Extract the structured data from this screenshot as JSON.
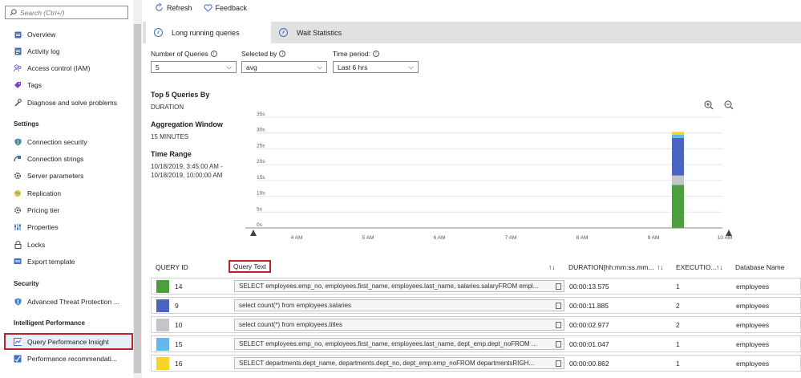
{
  "sidebar": {
    "search_placeholder": "Search (Ctrl+/)",
    "items": [
      {
        "label": "Overview",
        "icon": "overview-icon"
      },
      {
        "label": "Activity log",
        "icon": "activity-log-icon"
      },
      {
        "label": "Access control (IAM)",
        "icon": "people-icon"
      },
      {
        "label": "Tags",
        "icon": "tag-icon"
      },
      {
        "label": "Diagnose and solve problems",
        "icon": "wrench-icon"
      }
    ],
    "settings_header": "Settings",
    "settings_items": [
      {
        "label": "Connection security",
        "icon": "shield-icon"
      },
      {
        "label": "Connection strings",
        "icon": "plug-icon"
      },
      {
        "label": "Server parameters",
        "icon": "gear-icon"
      },
      {
        "label": "Replication",
        "icon": "globe-icon"
      },
      {
        "label": "Pricing tier",
        "icon": "gear-icon"
      },
      {
        "label": "Properties",
        "icon": "sliders-icon"
      },
      {
        "label": "Locks",
        "icon": "lock-icon"
      },
      {
        "label": "Export template",
        "icon": "export-icon"
      }
    ],
    "security_header": "Security",
    "security_items": [
      {
        "label": "Advanced Threat Protection ...",
        "icon": "shield-icon"
      }
    ],
    "intelligent_header": "Intelligent Performance",
    "intelligent_items": [
      {
        "label": "Query Performance Insight",
        "icon": "chart-icon"
      },
      {
        "label": "Performance recommendati...",
        "icon": "recommendation-icon"
      }
    ]
  },
  "toolbar": {
    "refresh": "Refresh",
    "feedback": "Feedback"
  },
  "tabs": [
    {
      "label": "Long running queries"
    },
    {
      "label": "Wait Statistics"
    }
  ],
  "filters": {
    "num_queries_label": "Number of Queries",
    "num_queries_value": "5",
    "selected_by_label": "Selected by",
    "selected_by_value": "avg",
    "time_period_label": "Time period:",
    "time_period_value": "Last 6 hrs"
  },
  "info": {
    "top_header": "Top 5 Queries By",
    "top_value": "DURATION",
    "agg_header": "Aggregation Window",
    "agg_value": "15 MINUTES",
    "range_header": "Time Range",
    "range_value": "10/18/2019, 3:45:00 AM - 10/18/2019, 10:00:00 AM"
  },
  "chart_data": {
    "type": "bar",
    "stacked": true,
    "y_ticks": [
      "0s",
      "5s",
      "10s",
      "15s",
      "20s",
      "25s",
      "30s",
      "35s"
    ],
    "x_ticks": [
      "4 AM",
      "5 AM",
      "6 AM",
      "7 AM",
      "8 AM",
      "9 AM",
      "10 AM"
    ],
    "ylim": [
      0,
      35
    ],
    "stack_at": "9 AM",
    "series": [
      {
        "query_id": "14",
        "color": "#4d9e3e",
        "value": 13.575
      },
      {
        "query_id": "10",
        "color": "#c4c5c8",
        "value": 2.977
      },
      {
        "query_id": "9",
        "color": "#4b64c2",
        "value": 11.885
      },
      {
        "query_id": "15",
        "color": "#64b9eb",
        "value": 1.047
      },
      {
        "query_id": "16",
        "color": "#f5d327",
        "value": 0.862
      }
    ]
  },
  "table": {
    "headers": {
      "id": "QUERY ID",
      "text": "Query Text",
      "duration": "DURATION[hh:mm:ss.mm...",
      "exec": "EXECUTIO...",
      "db": "Database Name"
    },
    "rows": [
      {
        "id": "14",
        "color": "#4d9e3e",
        "text": "SELECT employees.emp_no, employees.first_name, employees.last_name, salaries.salaryFROM empl...",
        "duration": "00:00:13.575",
        "exec": "1",
        "db": "employees"
      },
      {
        "id": "9",
        "color": "#4b64c2",
        "text": "select count(*) from employees.salaries",
        "duration": "00:00:11.885",
        "exec": "2",
        "db": "employees"
      },
      {
        "id": "10",
        "color": "#c4c5c8",
        "text": "select count(*) from employees.titles",
        "duration": "00:00:02.977",
        "exec": "2",
        "db": "employees"
      },
      {
        "id": "15",
        "color": "#64b9eb",
        "text": "SELECT employees.emp_no, employees.first_name, employees.last_name, dept_emp.dept_noFROM ...",
        "duration": "00:00:01.047",
        "exec": "1",
        "db": "employees"
      },
      {
        "id": "16",
        "color": "#f5d327",
        "text": "SELECT departments.dept_name, departments.dept_no, dept_emp.emp_noFROM departmentsRIGH...",
        "duration": "00:00:00.862",
        "exec": "1",
        "db": "employees"
      }
    ]
  }
}
